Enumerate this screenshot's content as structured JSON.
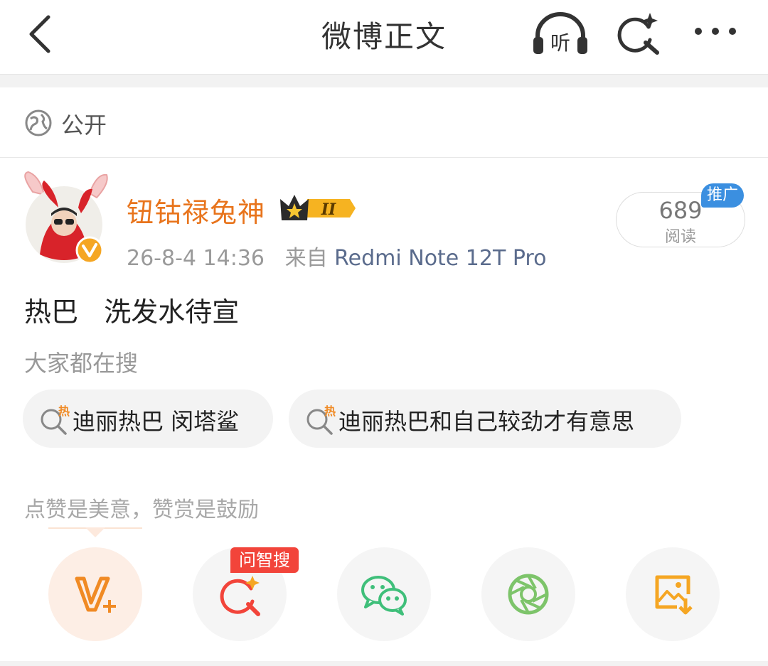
{
  "header": {
    "title": "微博正文",
    "listen_label": "听"
  },
  "visibility": {
    "label": "公开"
  },
  "post": {
    "username": "钮钴禄兔神",
    "vip_level": "II",
    "time": "26-8-4 14:36",
    "source_prefix": "来自",
    "source_device": "Redmi Note 12T Pro",
    "read_count": "689",
    "read_label": "阅读",
    "promo_badge": "推广",
    "text": "热巴   洗发水待宣"
  },
  "search_section": {
    "heading": "大家都在搜",
    "chips": [
      {
        "label": "迪丽热巴 闵塔鲨"
      },
      {
        "label": "迪丽热巴和自己较劲才有意思"
      }
    ],
    "hot_badge": "热"
  },
  "actions": {
    "hint": "点赞是美意，赞赏是鼓励",
    "ask_badge": "问智搜"
  },
  "colors": {
    "username": "#e8741c",
    "source": "#5a6b8c",
    "promo": "#3b8fe0",
    "ask_badge": "#f2443a",
    "reward_bg": "#fdeee5",
    "wechat": "#3fbf7a",
    "moments": "#7dc46a",
    "save_image": "#f5a623"
  },
  "icons": [
    "back-icon",
    "headphones-icon",
    "ai-search-icon",
    "more-icon",
    "globe-icon",
    "vip-crown-icon",
    "verified-icon",
    "hot-search-icon",
    "reward-icon",
    "wechat-icon",
    "moments-icon",
    "save-image-icon"
  ]
}
